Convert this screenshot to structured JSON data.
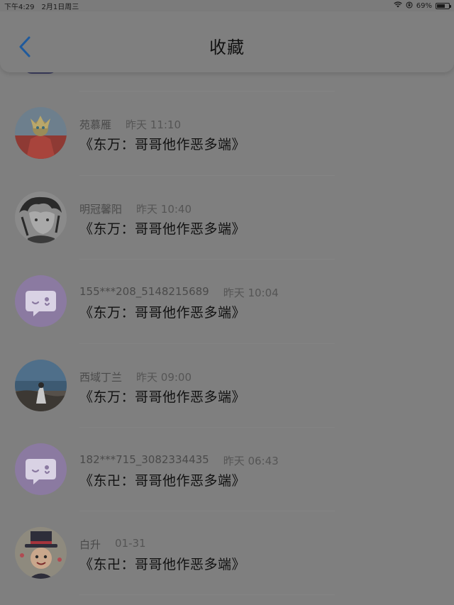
{
  "status_bar": {
    "time": "下午4:29",
    "date": "2月1日周三",
    "battery": "69%",
    "battery_level": 0.69
  },
  "header": {
    "title": "收藏",
    "back_icon": "chevron-left-icon"
  },
  "items": [
    {
      "name": "苑慕雁",
      "time": "昨天 11:10",
      "content": "《东万：哥哥他作恶多端》",
      "avatar": "anime-hero-avatar"
    },
    {
      "name": "明冠馨阳",
      "time": "昨天 10:40",
      "content": "《东万：哥哥他作恶多端》",
      "avatar": "anime-sketch-avatar"
    },
    {
      "name": "155***208_5148215689",
      "time": "昨天 10:04",
      "content": "《东万：哥哥他作恶多端》",
      "avatar": "default-chat-avatar"
    },
    {
      "name": "西域丁兰",
      "time": "昨天 09:00",
      "content": "《东万：哥哥他作恶多端》",
      "avatar": "seaside-photo-avatar"
    },
    {
      "name": "182***715_3082334435",
      "time": "昨天 06:43",
      "content": "《东卍：哥哥他作恶多端》",
      "avatar": "default-chat-avatar"
    },
    {
      "name": "白升",
      "time": "01-31",
      "content": "《东卍：哥哥他作恶多端》",
      "avatar": "cartoon-hat-avatar"
    }
  ],
  "colors": {
    "background": "#7f7f7f",
    "back_arrow": "#1f5a9c",
    "default_avatar_bg": "#8b7aa1"
  }
}
